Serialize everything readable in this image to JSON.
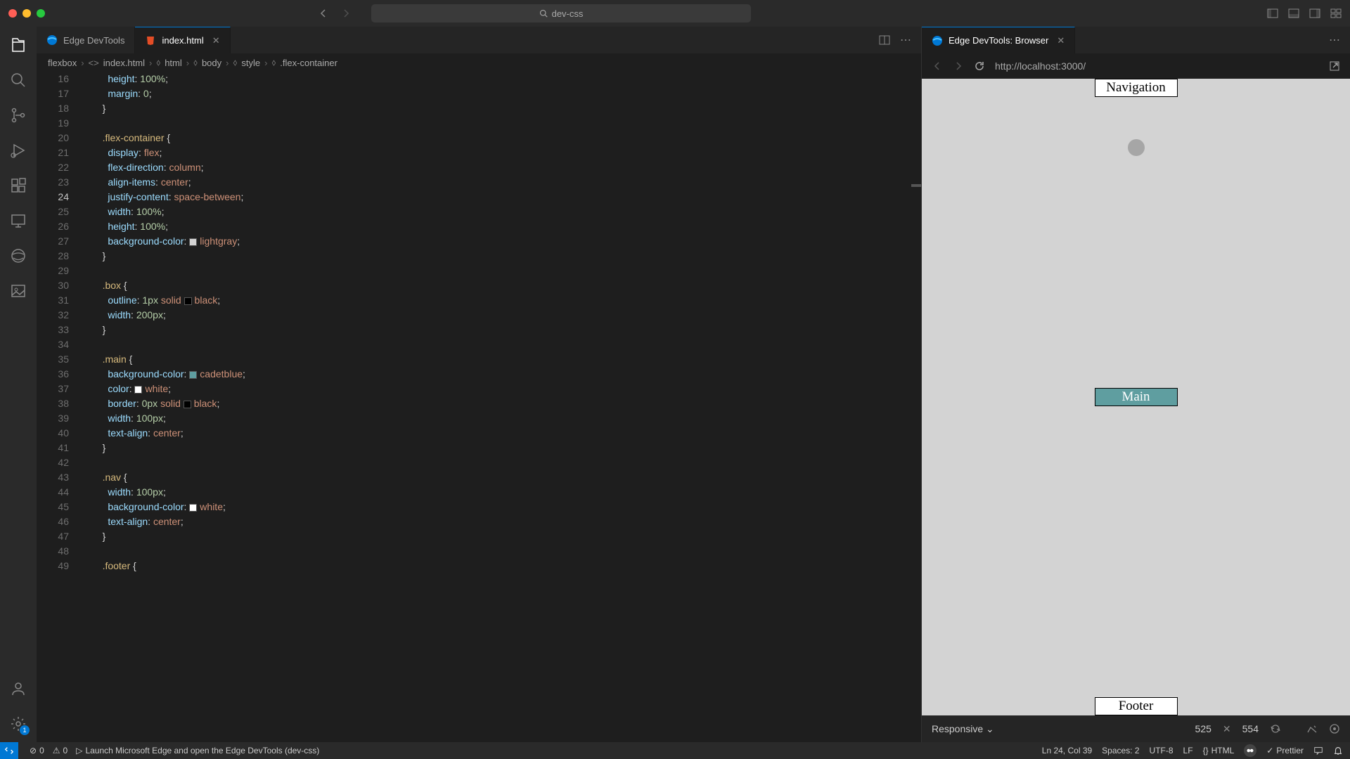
{
  "titlebar": {
    "search_text": "dev-css"
  },
  "tabs": {
    "devtools": "Edge DevTools",
    "indexhtml": "index.html",
    "browser": "Edge DevTools: Browser"
  },
  "breadcrumbs": {
    "project": "flexbox",
    "file": "index.html",
    "html": "html",
    "body": "body",
    "style": "style",
    "selector": ".flex-container"
  },
  "code": {
    "line_start": 16,
    "active_line": 24,
    "lines": [
      {
        "n": 16,
        "indent": 3,
        "segs": [
          {
            "t": "height",
            "c": "tok-prop"
          },
          {
            "t": ": ",
            "c": "tok-punc"
          },
          {
            "t": "100%",
            "c": "tok-num"
          },
          {
            "t": ";",
            "c": "tok-punc"
          }
        ]
      },
      {
        "n": 17,
        "indent": 3,
        "segs": [
          {
            "t": "margin",
            "c": "tok-prop"
          },
          {
            "t": ": ",
            "c": "tok-punc"
          },
          {
            "t": "0",
            "c": "tok-num"
          },
          {
            "t": ";",
            "c": "tok-punc"
          }
        ]
      },
      {
        "n": 18,
        "indent": 2,
        "segs": [
          {
            "t": "}",
            "c": "tok-punc"
          }
        ]
      },
      {
        "n": 19,
        "indent": 0,
        "segs": []
      },
      {
        "n": 20,
        "indent": 2,
        "segs": [
          {
            "t": ".flex-container",
            "c": "tok-sel"
          },
          {
            "t": " {",
            "c": "tok-punc"
          }
        ]
      },
      {
        "n": 21,
        "indent": 3,
        "segs": [
          {
            "t": "display",
            "c": "tok-prop"
          },
          {
            "t": ": ",
            "c": "tok-punc"
          },
          {
            "t": "flex",
            "c": "tok-val"
          },
          {
            "t": ";",
            "c": "tok-punc"
          }
        ]
      },
      {
        "n": 22,
        "indent": 3,
        "segs": [
          {
            "t": "flex-direction",
            "c": "tok-prop"
          },
          {
            "t": ": ",
            "c": "tok-punc"
          },
          {
            "t": "column",
            "c": "tok-val"
          },
          {
            "t": ";",
            "c": "tok-punc"
          }
        ]
      },
      {
        "n": 23,
        "indent": 3,
        "segs": [
          {
            "t": "align-items",
            "c": "tok-prop"
          },
          {
            "t": ": ",
            "c": "tok-punc"
          },
          {
            "t": "center",
            "c": "tok-val"
          },
          {
            "t": ";",
            "c": "tok-punc"
          }
        ]
      },
      {
        "n": 24,
        "indent": 3,
        "segs": [
          {
            "t": "justify-content",
            "c": "tok-prop"
          },
          {
            "t": ": ",
            "c": "tok-punc"
          },
          {
            "t": "space-between",
            "c": "tok-val"
          },
          {
            "t": ";",
            "c": "tok-punc"
          }
        ]
      },
      {
        "n": 25,
        "indent": 3,
        "segs": [
          {
            "t": "width",
            "c": "tok-prop"
          },
          {
            "t": ": ",
            "c": "tok-punc"
          },
          {
            "t": "100%",
            "c": "tok-num"
          },
          {
            "t": ";",
            "c": "tok-punc"
          }
        ]
      },
      {
        "n": 26,
        "indent": 3,
        "segs": [
          {
            "t": "height",
            "c": "tok-prop"
          },
          {
            "t": ": ",
            "c": "tok-punc"
          },
          {
            "t": "100%",
            "c": "tok-num"
          },
          {
            "t": ";",
            "c": "tok-punc"
          }
        ]
      },
      {
        "n": 27,
        "indent": 3,
        "segs": [
          {
            "t": "background-color",
            "c": "tok-prop"
          },
          {
            "t": ": ",
            "c": "tok-punc"
          },
          {
            "sw": "#d3d3d3"
          },
          {
            "t": "lightgray",
            "c": "tok-val"
          },
          {
            "t": ";",
            "c": "tok-punc"
          }
        ]
      },
      {
        "n": 28,
        "indent": 2,
        "segs": [
          {
            "t": "}",
            "c": "tok-punc"
          }
        ]
      },
      {
        "n": 29,
        "indent": 0,
        "segs": []
      },
      {
        "n": 30,
        "indent": 2,
        "segs": [
          {
            "t": ".box",
            "c": "tok-sel"
          },
          {
            "t": " {",
            "c": "tok-punc"
          }
        ]
      },
      {
        "n": 31,
        "indent": 3,
        "segs": [
          {
            "t": "outline",
            "c": "tok-prop"
          },
          {
            "t": ": ",
            "c": "tok-punc"
          },
          {
            "t": "1px",
            "c": "tok-num"
          },
          {
            "t": " ",
            "c": "tok-punc"
          },
          {
            "t": "solid",
            "c": "tok-val"
          },
          {
            "t": " ",
            "c": "tok-punc"
          },
          {
            "sw": "#000000"
          },
          {
            "t": "black",
            "c": "tok-val"
          },
          {
            "t": ";",
            "c": "tok-punc"
          }
        ]
      },
      {
        "n": 32,
        "indent": 3,
        "segs": [
          {
            "t": "width",
            "c": "tok-prop"
          },
          {
            "t": ": ",
            "c": "tok-punc"
          },
          {
            "t": "200px",
            "c": "tok-num"
          },
          {
            "t": ";",
            "c": "tok-punc"
          }
        ]
      },
      {
        "n": 33,
        "indent": 2,
        "segs": [
          {
            "t": "}",
            "c": "tok-punc"
          }
        ]
      },
      {
        "n": 34,
        "indent": 0,
        "segs": []
      },
      {
        "n": 35,
        "indent": 2,
        "segs": [
          {
            "t": ".main",
            "c": "tok-sel"
          },
          {
            "t": " {",
            "c": "tok-punc"
          }
        ]
      },
      {
        "n": 36,
        "indent": 3,
        "segs": [
          {
            "t": "background-color",
            "c": "tok-prop"
          },
          {
            "t": ": ",
            "c": "tok-punc"
          },
          {
            "sw": "#5f9ea0"
          },
          {
            "t": "cadetblue",
            "c": "tok-val"
          },
          {
            "t": ";",
            "c": "tok-punc"
          }
        ]
      },
      {
        "n": 37,
        "indent": 3,
        "segs": [
          {
            "t": "color",
            "c": "tok-prop"
          },
          {
            "t": ": ",
            "c": "tok-punc"
          },
          {
            "sw": "#ffffff"
          },
          {
            "t": "white",
            "c": "tok-val"
          },
          {
            "t": ";",
            "c": "tok-punc"
          }
        ]
      },
      {
        "n": 38,
        "indent": 3,
        "segs": [
          {
            "t": "border",
            "c": "tok-prop"
          },
          {
            "t": ": ",
            "c": "tok-punc"
          },
          {
            "t": "0px",
            "c": "tok-num"
          },
          {
            "t": " ",
            "c": "tok-punc"
          },
          {
            "t": "solid",
            "c": "tok-val"
          },
          {
            "t": " ",
            "c": "tok-punc"
          },
          {
            "sw": "#000000"
          },
          {
            "t": "black",
            "c": "tok-val"
          },
          {
            "t": ";",
            "c": "tok-punc"
          }
        ]
      },
      {
        "n": 39,
        "indent": 3,
        "segs": [
          {
            "t": "width",
            "c": "tok-prop"
          },
          {
            "t": ": ",
            "c": "tok-punc"
          },
          {
            "t": "100px",
            "c": "tok-num"
          },
          {
            "t": ";",
            "c": "tok-punc"
          }
        ]
      },
      {
        "n": 40,
        "indent": 3,
        "segs": [
          {
            "t": "text-align",
            "c": "tok-prop"
          },
          {
            "t": ": ",
            "c": "tok-punc"
          },
          {
            "t": "center",
            "c": "tok-val"
          },
          {
            "t": ";",
            "c": "tok-punc"
          }
        ]
      },
      {
        "n": 41,
        "indent": 2,
        "segs": [
          {
            "t": "}",
            "c": "tok-punc"
          }
        ]
      },
      {
        "n": 42,
        "indent": 0,
        "segs": []
      },
      {
        "n": 43,
        "indent": 2,
        "segs": [
          {
            "t": ".nav",
            "c": "tok-sel"
          },
          {
            "t": " {",
            "c": "tok-punc"
          }
        ]
      },
      {
        "n": 44,
        "indent": 3,
        "segs": [
          {
            "t": "width",
            "c": "tok-prop"
          },
          {
            "t": ": ",
            "c": "tok-punc"
          },
          {
            "t": "100px",
            "c": "tok-num"
          },
          {
            "t": ";",
            "c": "tok-punc"
          }
        ]
      },
      {
        "n": 45,
        "indent": 3,
        "segs": [
          {
            "t": "background-color",
            "c": "tok-prop"
          },
          {
            "t": ": ",
            "c": "tok-punc"
          },
          {
            "sw": "#ffffff"
          },
          {
            "t": "white",
            "c": "tok-val"
          },
          {
            "t": ";",
            "c": "tok-punc"
          }
        ]
      },
      {
        "n": 46,
        "indent": 3,
        "segs": [
          {
            "t": "text-align",
            "c": "tok-prop"
          },
          {
            "t": ": ",
            "c": "tok-punc"
          },
          {
            "t": "center",
            "c": "tok-val"
          },
          {
            "t": ";",
            "c": "tok-punc"
          }
        ]
      },
      {
        "n": 47,
        "indent": 2,
        "segs": [
          {
            "t": "}",
            "c": "tok-punc"
          }
        ]
      },
      {
        "n": 48,
        "indent": 0,
        "segs": []
      },
      {
        "n": 49,
        "indent": 2,
        "segs": [
          {
            "t": ".footer",
            "c": "tok-sel"
          },
          {
            "t": " {",
            "c": "tok-punc"
          }
        ]
      }
    ]
  },
  "browser": {
    "url": "http://localhost:3000/",
    "nav_text": "Navigation",
    "main_text": "Main",
    "footer_text": "Footer"
  },
  "device": {
    "mode": "Responsive",
    "width": "525",
    "height": "554"
  },
  "status": {
    "errors": "0",
    "warnings": "0",
    "launch": "Launch Microsoft Edge and open the Edge DevTools (dev-css)",
    "cursor": "Ln 24, Col 39",
    "spaces": "Spaces: 2",
    "encoding": "UTF-8",
    "eol": "LF",
    "lang": "HTML",
    "prettier": "Prettier"
  }
}
